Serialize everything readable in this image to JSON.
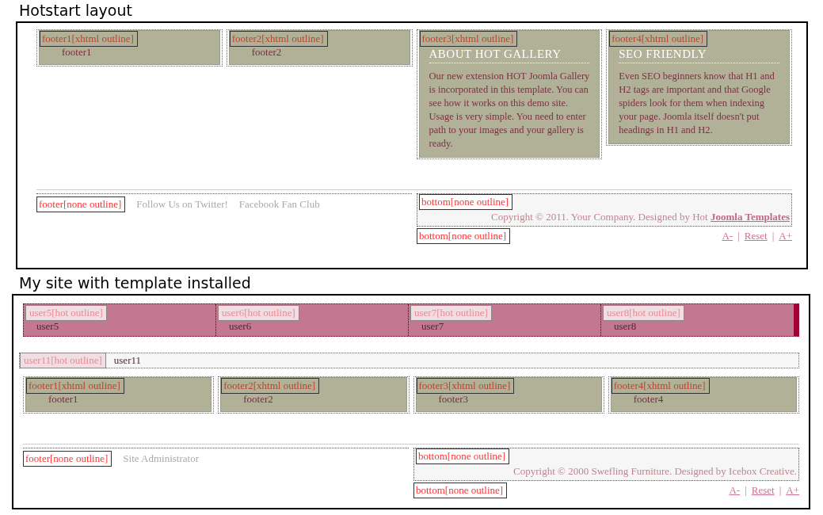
{
  "sections": [
    {
      "title": "Hotstart layout",
      "footer_modules": [
        {
          "tag": "footer1[xhtml outline]",
          "name": "footer1"
        },
        {
          "tag": "footer2[xhtml outline]",
          "name": "footer2"
        },
        {
          "tag": "footer3[xhtml outline]",
          "heading": "ABOUT HOT GALLERY",
          "body": "Our new extension HOT Joomla Gallery is incorporated in this template. You can see how it works on this demo site. Usage is very simple. You need to enter path to your images and your gallery is ready."
        },
        {
          "tag": "footer4[xhtml outline]",
          "heading": "SEO FRIENDLY",
          "body": "Even SEO beginners know that H1 and H2 tags are important and that Google spiders look for them when indexing your page. Joomla itself doesn't put headings in H1 and H2."
        }
      ],
      "footer": {
        "tag": "footer[none outline]",
        "links": [
          "Follow Us on Twitter!",
          "Facebook Fan Club"
        ]
      },
      "bottom": {
        "tags": [
          "bottom[none outline]",
          "bottom[none outline]"
        ],
        "copyright": "Copyright © 2011. Your Company. Designed by Hot",
        "link": "Joomla Templates"
      },
      "font_controls": {
        "items": [
          "A-",
          "Reset",
          "A+"
        ],
        "separator": "|"
      }
    },
    {
      "title": "My site with template installed",
      "user_modules": [
        {
          "tag": "user5[hot outline]",
          "name": "user5"
        },
        {
          "tag": "user6[hot outline]",
          "name": "user6"
        },
        {
          "tag": "user7[hot outline]",
          "name": "user7"
        },
        {
          "tag": "user8[hot outline]",
          "name": "user8"
        }
      ],
      "wide_module": {
        "tag": "user11[hot outline]",
        "name": "user11"
      },
      "footer_modules": [
        {
          "tag": "footer1[xhtml outline]",
          "name": "footer1"
        },
        {
          "tag": "footer2[xhtml outline]",
          "name": "footer2"
        },
        {
          "tag": "footer3[xhtml outline]",
          "name": "footer3"
        },
        {
          "tag": "footer4[xhtml outline]",
          "name": "footer4"
        }
      ],
      "footer": {
        "tag": "footer[none outline]",
        "links": [
          "Site Administrator"
        ]
      },
      "bottom": {
        "tags": [
          "bottom[none outline]",
          "bottom[none outline]"
        ],
        "copyright": "Copyright © 2000 Swefling Furniture.   Designed by Icebox Creative."
      },
      "font_controls": {
        "items": [
          "A-",
          "Reset",
          "A+"
        ],
        "separator": "|"
      }
    }
  ]
}
